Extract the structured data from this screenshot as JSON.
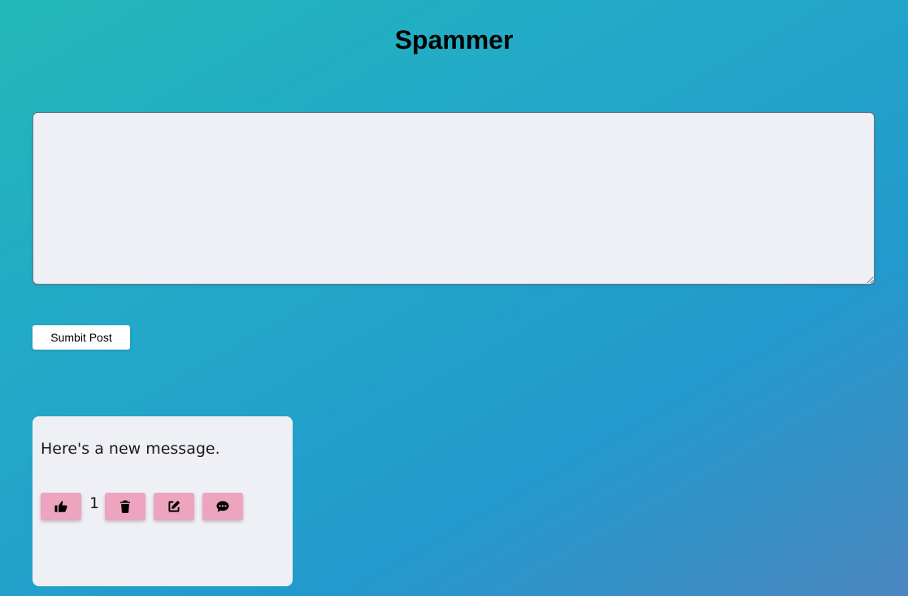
{
  "app": {
    "title": "Spammer"
  },
  "composer": {
    "value": "",
    "placeholder": "",
    "submit_label": "Sumbit Post"
  },
  "posts": [
    {
      "text": "Here's a new message.",
      "like_count": "1",
      "actions": [
        {
          "name": "like-button",
          "icon": "thumbs-up-icon"
        },
        {
          "name": "delete-button",
          "icon": "trash-icon"
        },
        {
          "name": "edit-button",
          "icon": "edit-icon"
        },
        {
          "name": "comment-button",
          "icon": "comment-dots-icon"
        }
      ]
    }
  ],
  "colors": {
    "background_gradient": [
      "#22b8b8",
      "#2399cd",
      "#4a86bf"
    ],
    "card_background": "#eff0f5",
    "action_button": "#eda4be",
    "submit_button": "#ffffff"
  }
}
